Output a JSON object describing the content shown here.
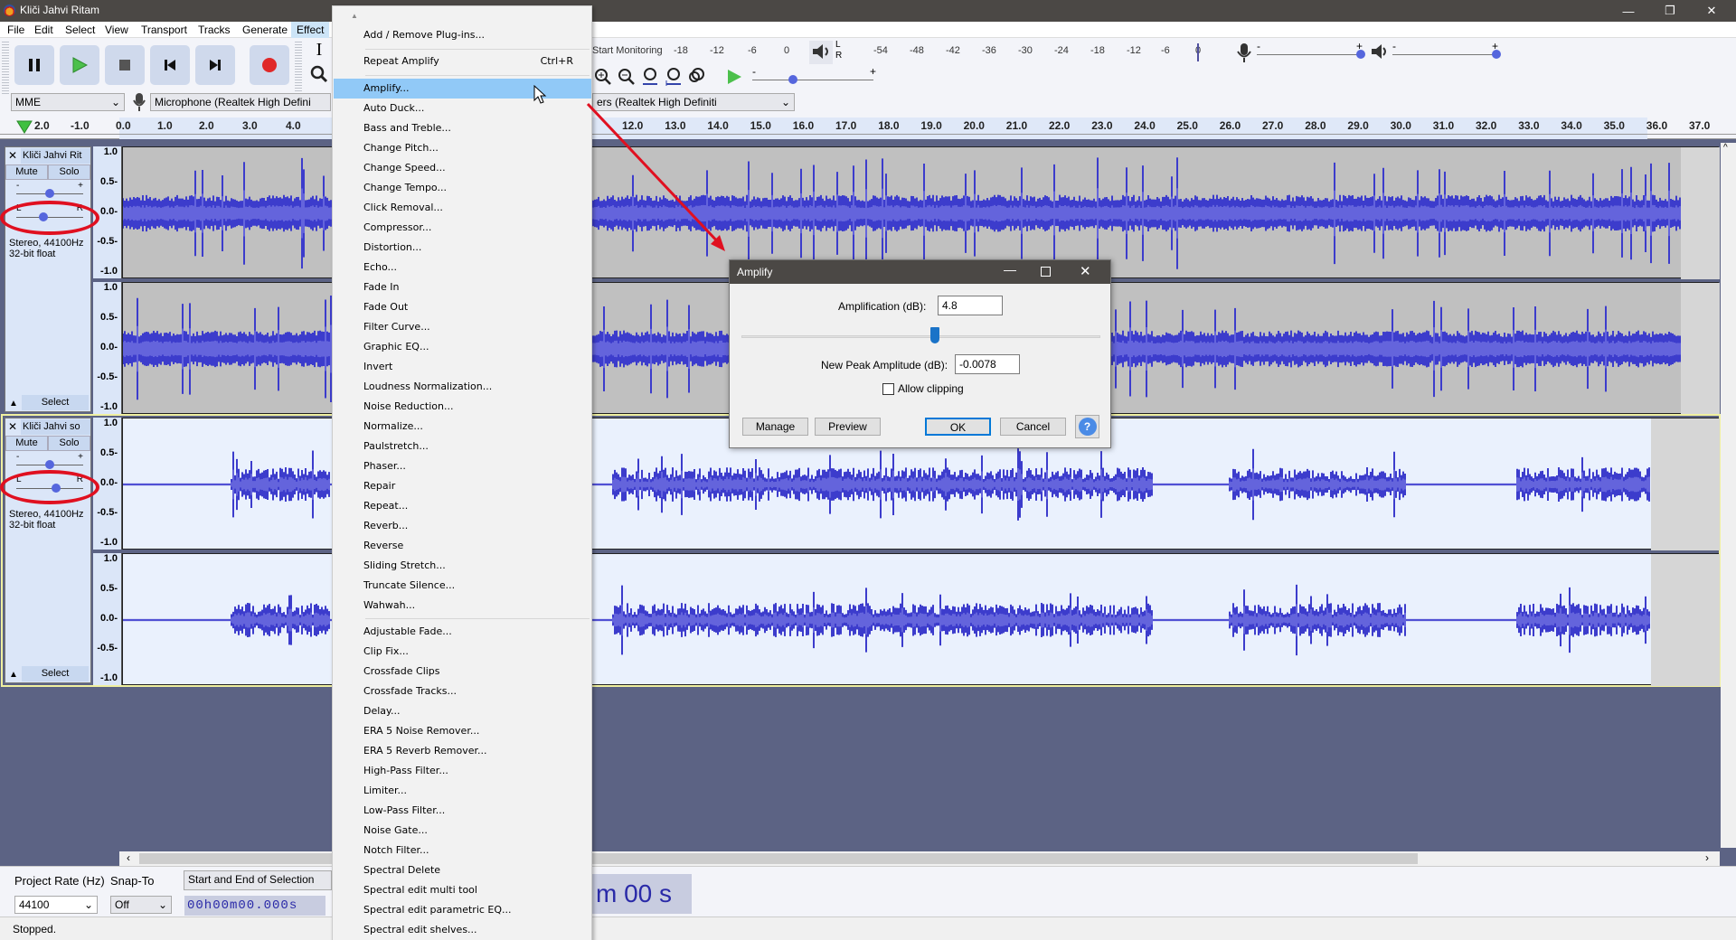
{
  "window": {
    "title": "Kliči Jahvi Ritam",
    "minimize": "—",
    "maximize": "❐",
    "close": "✕"
  },
  "menubar": {
    "items": [
      "File",
      "Edit",
      "Select",
      "View",
      "Transport",
      "Tracks",
      "Generate",
      "Effect"
    ],
    "active": "Effect"
  },
  "transport": {
    "pause": "pause-icon",
    "play": "play-icon",
    "stop": "stop-icon",
    "skip_start": "skip-start-icon",
    "skip_end": "skip-end-icon",
    "record": "record-icon"
  },
  "tools": {
    "select": "I",
    "zoom": "🔍"
  },
  "record_meter": {
    "label": "Start Monitoring",
    "ticks": [
      "-18",
      "-12",
      "-6",
      "0"
    ]
  },
  "play_meter": {
    "L": "L",
    "R": "R",
    "ticks": [
      "-54",
      "-48",
      "-42",
      "-36",
      "-30",
      "-24",
      "-18",
      "-12",
      "-6",
      "0"
    ]
  },
  "mixer": {
    "minus": "-",
    "plus": "+"
  },
  "device": {
    "host": "MME",
    "mic": "Microphone (Realtek High Defini",
    "speakers": "ers (Realtek High Definiti"
  },
  "ruler": {
    "left_labels": [
      "2.0",
      "-1.0",
      "0.0",
      "1.0",
      "2.0",
      "3.0",
      "4.0"
    ],
    "right_labels": [
      "12.0",
      "13.0",
      "14.0",
      "15.0",
      "16.0",
      "17.0",
      "18.0",
      "19.0",
      "20.0",
      "21.0",
      "22.0",
      "23.0",
      "24.0",
      "25.0",
      "26.0",
      "27.0",
      "28.0",
      "29.0",
      "30.0",
      "31.0",
      "32.0",
      "33.0",
      "34.0",
      "35.0",
      "36.0",
      "37.0"
    ]
  },
  "tracks": [
    {
      "name": "Kliči Jahvi Rit",
      "mute": "Mute",
      "solo": "Solo",
      "gain_minus": "-",
      "gain_plus": "+",
      "pan_L": "L",
      "pan_R": "R",
      "info1": "Stereo, 44100Hz",
      "info2": "32-bit float",
      "select": "Select",
      "scale": [
        "1.0",
        "0.5-",
        "0.0-",
        "-0.5-",
        "-1.0"
      ],
      "gain": 0.5,
      "pan": 0.4
    },
    {
      "name": "Kliči Jahvi so",
      "mute": "Mute",
      "solo": "Solo",
      "gain_minus": "-",
      "gain_plus": "+",
      "pan_L": "L",
      "pan_R": "R",
      "info1": "Stereo, 44100Hz",
      "info2": "32-bit float",
      "select": "Select",
      "scale": [
        "1.0",
        "0.5-",
        "0.0-",
        "-0.5-",
        "-1.0"
      ],
      "gain": 0.5,
      "pan": 0.6
    }
  ],
  "effect_menu": {
    "top": [
      {
        "label": "Add / Remove Plug-ins..."
      },
      {
        "label": "Repeat Amplify",
        "shortcut": "Ctrl+R"
      }
    ],
    "items": [
      "Amplify...",
      "Auto Duck...",
      "Bass and Treble...",
      "Change Pitch...",
      "Change Speed...",
      "Change Tempo...",
      "Click Removal...",
      "Compressor...",
      "Distortion...",
      "Echo...",
      "Fade In",
      "Fade Out",
      "Filter Curve...",
      "Graphic EQ...",
      "Invert",
      "Loudness Normalization...",
      "Noise Reduction...",
      "Normalize...",
      "Paulstretch...",
      "Phaser...",
      "Repair",
      "Repeat...",
      "Reverb...",
      "Reverse",
      "Sliding Stretch...",
      "Truncate Silence...",
      "Wahwah..."
    ],
    "plugins": [
      "Adjustable Fade...",
      "Clip Fix...",
      "Crossfade Clips",
      "Crossfade Tracks...",
      "Delay...",
      "ERA 5 Noise Remover...",
      "ERA 5 Reverb Remover...",
      "High-Pass Filter...",
      "Limiter...",
      "Low-Pass Filter...",
      "Noise Gate...",
      "Notch Filter...",
      "Spectral Delete",
      "Spectral edit multi tool",
      "Spectral edit parametric EQ...",
      "Spectral edit shelves..."
    ],
    "highlighted": "Amplify..."
  },
  "amplify_dialog": {
    "title": "Amplify",
    "amp_label": "Amplification (dB):",
    "amp_value": "4.8",
    "slider_fraction": 0.54,
    "peak_label": "New Peak Amplitude (dB):",
    "peak_value": "-0.0078",
    "clip_label": "Allow clipping",
    "clip_checked": false,
    "manage": "Manage",
    "preview": "Preview",
    "ok": "OK",
    "cancel": "Cancel",
    "help": "?"
  },
  "selection_bar": {
    "rate_label": "Project Rate (Hz)",
    "rate_value": "44100",
    "snap_label": "Snap-To",
    "snap_value": "Off",
    "sel_label": "Start and End of Selection",
    "sel_value": "00h00m00.000s",
    "big_time": "m 00 s"
  },
  "status": {
    "text": "Stopped."
  },
  "colors": {
    "waveform": "#3c3ccc",
    "waveform_rms": "#6464dc",
    "menu_highlight": "#91c9f7",
    "annotation": "#e01020"
  }
}
